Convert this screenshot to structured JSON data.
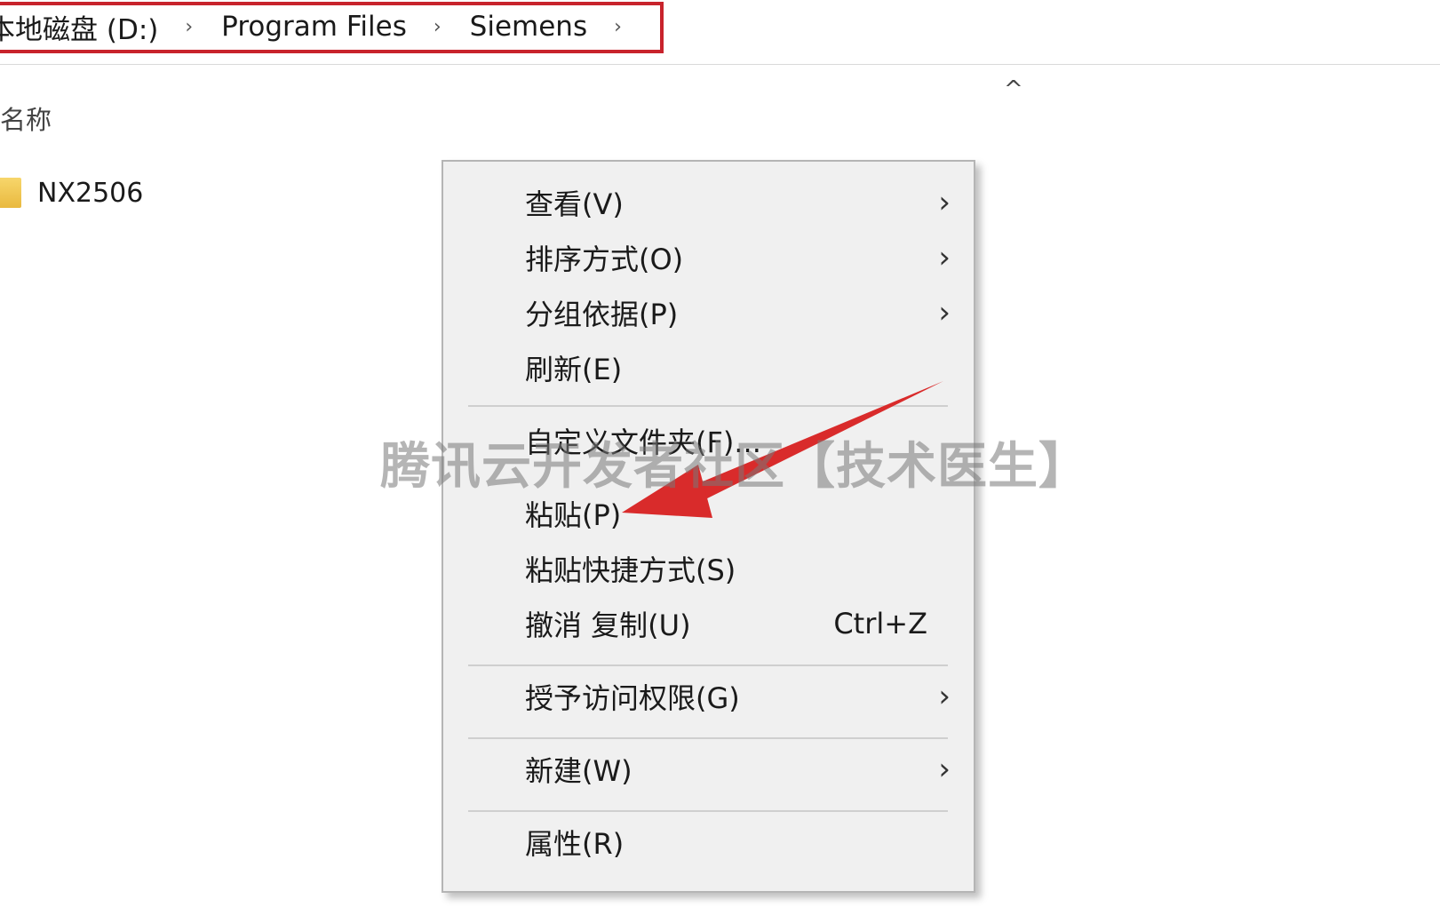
{
  "breadcrumb": {
    "segments": [
      "本地磁盘 (D:)",
      "Program Files",
      "Siemens"
    ],
    "separator": "›"
  },
  "list": {
    "column_name": "名称",
    "sort_caret": "^",
    "items": [
      {
        "name": "NX2506"
      }
    ]
  },
  "context_menu": {
    "items": [
      {
        "label": "查看(V)",
        "has_submenu": true
      },
      {
        "label": "排序方式(O)",
        "has_submenu": true
      },
      {
        "label": "分组依据(P)",
        "has_submenu": true
      },
      {
        "label": "刷新(E)",
        "has_submenu": false
      },
      {
        "label": "自定义文件夹(F)...",
        "has_submenu": false
      },
      {
        "label": "粘贴(P)",
        "has_submenu": false
      },
      {
        "label": "粘贴快捷方式(S)",
        "has_submenu": false
      },
      {
        "label": "撤消 复制(U)",
        "shortcut": "Ctrl+Z",
        "has_submenu": false
      },
      {
        "label": "授予访问权限(G)",
        "has_submenu": true
      },
      {
        "label": "新建(W)",
        "has_submenu": true
      },
      {
        "label": "属性(R)",
        "has_submenu": false
      }
    ],
    "chevron": "›"
  },
  "watermark": "腾讯云开发者社区【技术医生】",
  "colors": {
    "highlight": "#c8232c",
    "arrow": "#d92b2b",
    "menu_bg": "#f0f0f0"
  }
}
